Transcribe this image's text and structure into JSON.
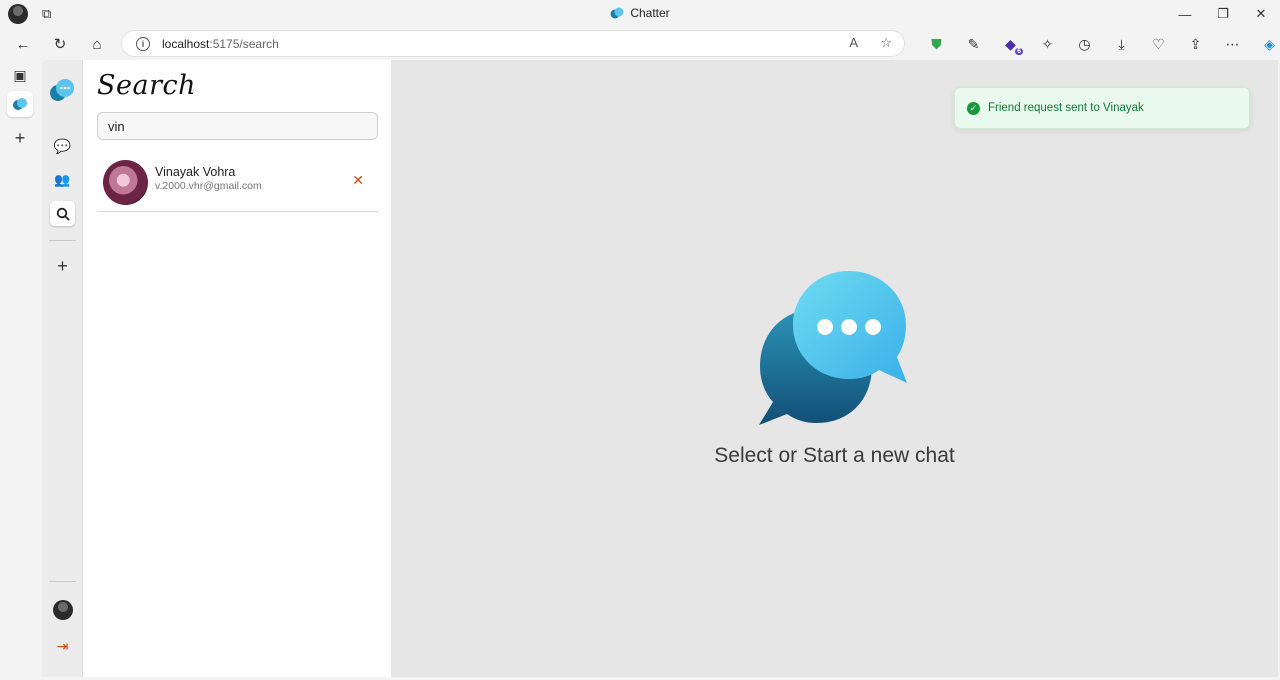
{
  "browser": {
    "tab_title": "Chatter",
    "url_host": "localhost",
    "url_path": ":5175/search",
    "extension_badge": "6",
    "window_controls": {
      "minimize": "—",
      "restore": "❐",
      "close": "✕"
    }
  },
  "app": {
    "search": {
      "title": "Search",
      "query": "vin"
    },
    "results": [
      {
        "name": "Vinayak Vohra",
        "email": "v.2000.vhr@gmail.com",
        "cancel_symbol": "✕"
      }
    ],
    "empty_state": "Select or Start a new chat",
    "toast": {
      "message": "Friend request sent to Vinayak",
      "status_color": "#17983c"
    }
  },
  "colors": {
    "accent": "#3aa6d9",
    "cancel": "#d04a10"
  }
}
